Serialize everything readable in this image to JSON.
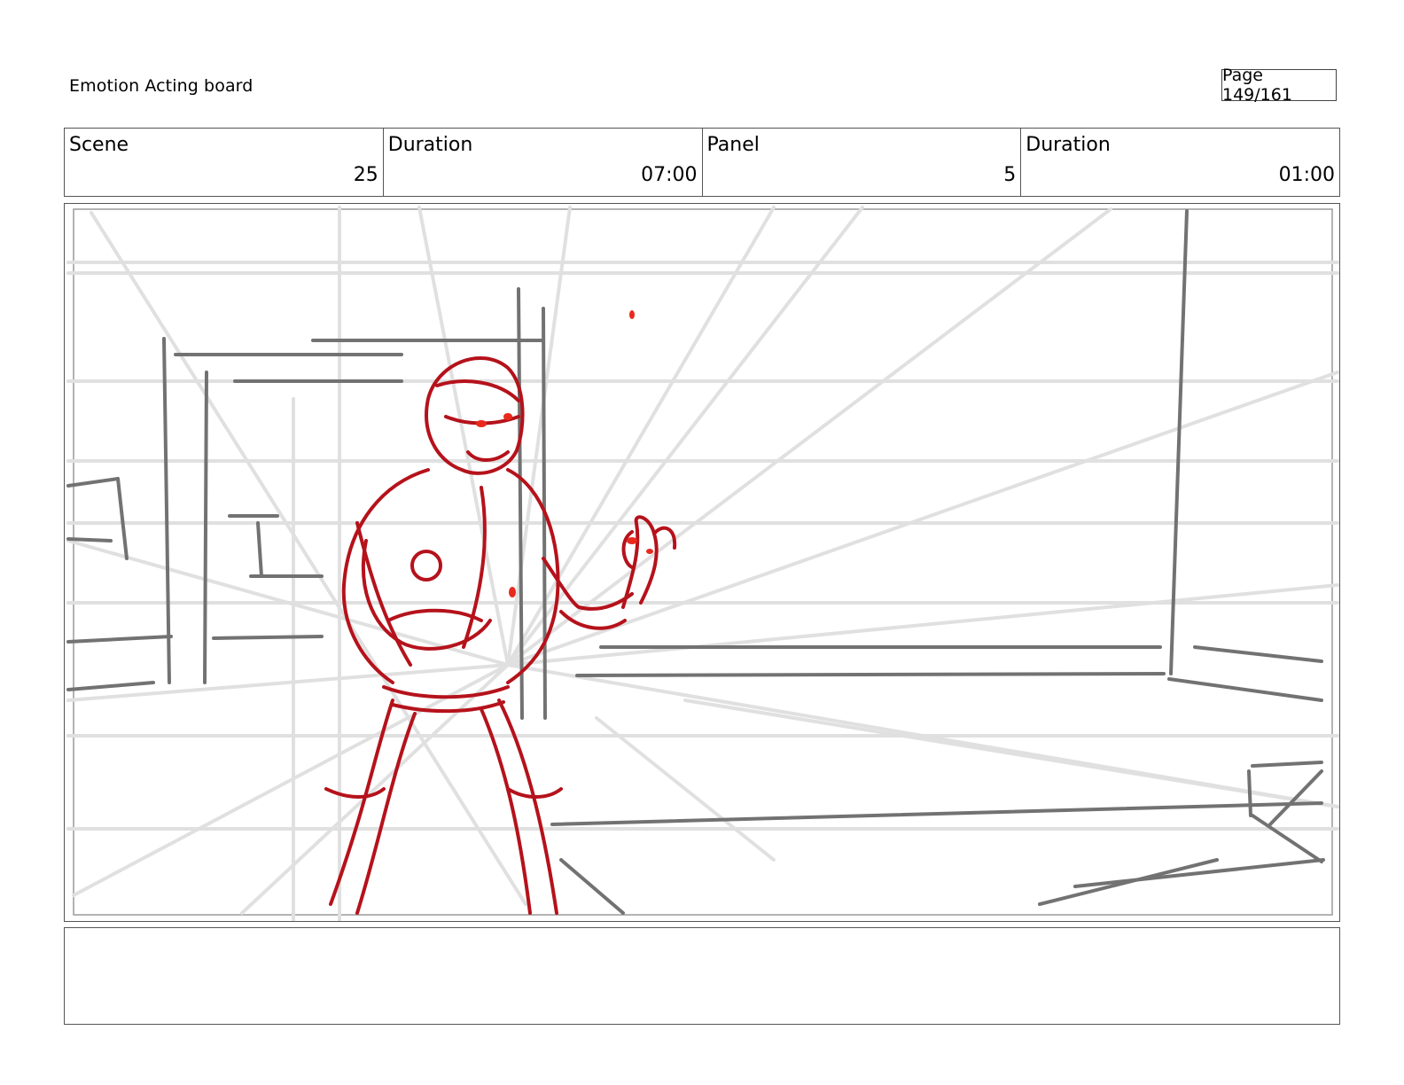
{
  "header": {
    "title": "Emotion Acting board",
    "page_label": "Page 149/161"
  },
  "meta": {
    "scene_label": "Scene",
    "scene_value": "25",
    "scene_duration_label": "Duration",
    "scene_duration_value": "07:00",
    "panel_label": "Panel",
    "panel_value": "5",
    "panel_duration_label": "Duration",
    "panel_duration_value": "01:00"
  },
  "colors": {
    "sketch_red": "#b5121b",
    "sketch_gray": "#707070",
    "guide_gray": "#dedede"
  }
}
